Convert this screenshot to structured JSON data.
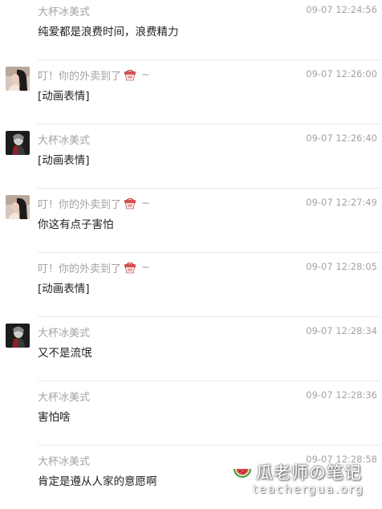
{
  "messages": [
    {
      "sender": "大杯冰美式",
      "time": "09-07 12:24:56",
      "text": "纯爱都是浪费时间，浪费精力",
      "avatar": "none",
      "emoji": false
    },
    {
      "sender": "叮！你的外卖到了",
      "time": "09-07 12:26:00",
      "text": "[动画表情]",
      "avatar": "photo-girl",
      "emoji": true,
      "suffix": "~"
    },
    {
      "sender": "大杯冰美式",
      "time": "09-07 12:26:40",
      "text": "[动画表情]",
      "avatar": "photo-dark",
      "emoji": false
    },
    {
      "sender": "叮！你的外卖到了",
      "time": "09-07 12:27:49",
      "text": "你这有点子害怕",
      "avatar": "photo-girl",
      "emoji": true,
      "suffix": "~"
    },
    {
      "sender": "叮！你的外卖到了",
      "time": "09-07 12:28:05",
      "text": "[动画表情]",
      "avatar": "none",
      "emoji": true,
      "suffix": "~"
    },
    {
      "sender": "大杯冰美式",
      "time": "09-07 12:28:34",
      "text": "又不是流氓",
      "avatar": "photo-dark",
      "emoji": false
    },
    {
      "sender": "大杯冰美式",
      "time": "09-07 12:28:36",
      "text": "害怕啥",
      "avatar": "none",
      "emoji": false
    },
    {
      "sender": "大杯冰美式",
      "time": "09-07 12:28:58",
      "text": "肯定是遵从人家的意愿啊",
      "avatar": "none",
      "emoji": false
    }
  ],
  "watermark": {
    "title": "瓜老师の笔记",
    "url": "teachergua.org",
    "icon": "watermelon-icon"
  }
}
